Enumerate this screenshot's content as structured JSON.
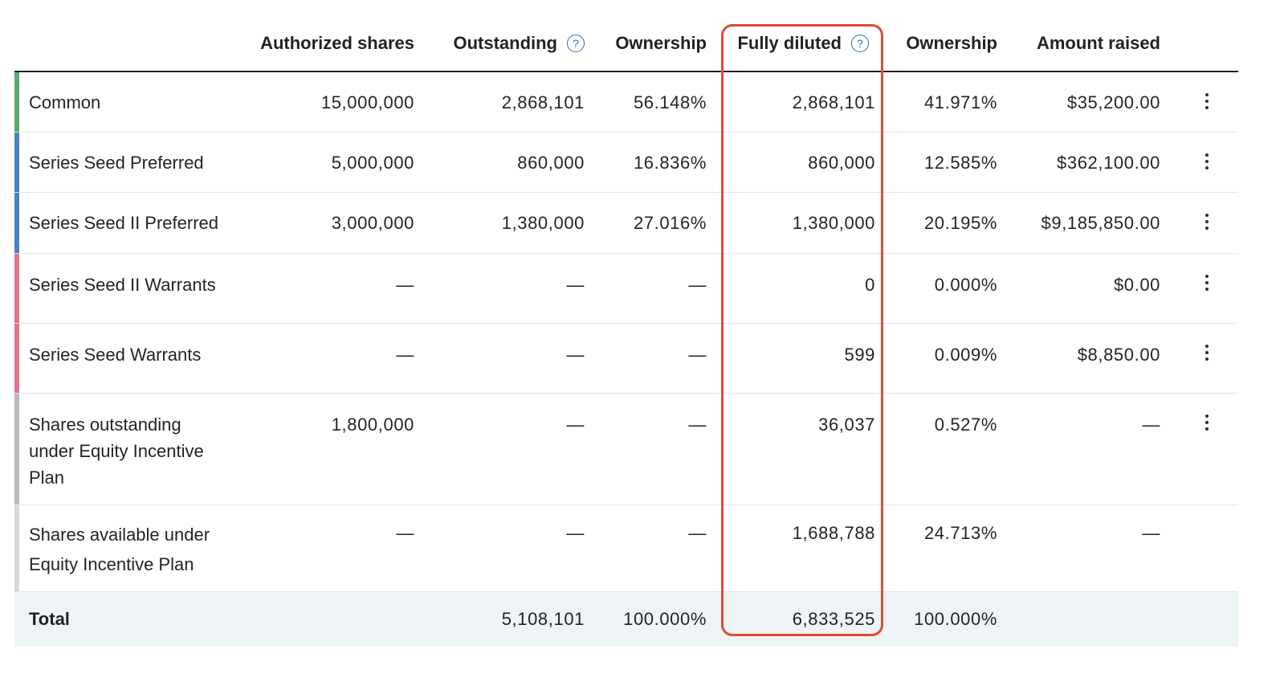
{
  "columns": {
    "authorized": "Authorized shares",
    "outstanding": "Outstanding",
    "ownership1": "Ownership",
    "fully_diluted": "Fully diluted",
    "ownership2": "Ownership",
    "amount_raised": "Amount raised",
    "help_glyph": "?"
  },
  "colors": {
    "accent_highlight": "#e04b32",
    "help_icon": "#2f6fb0",
    "total_row_bg": "#eef4f5",
    "common": "#5aa86f",
    "preferred": "#4a7fc0",
    "warrants": "#e0768a",
    "plan_outstanding": "#b9b9b9",
    "plan_available": "#d8d8d8"
  },
  "rows": [
    {
      "name": "Common",
      "authorized": "15,000,000",
      "outstanding": "2,868,101",
      "ownership1": "56.148%",
      "fully_diluted": "2,868,101",
      "ownership2": "41.971%",
      "amount_raised": "$35,200.00",
      "menu": "more-options"
    },
    {
      "name": "Series Seed Preferred",
      "authorized": "5,000,000",
      "outstanding": "860,000",
      "ownership1": "16.836%",
      "fully_diluted": "860,000",
      "ownership2": "12.585%",
      "amount_raised": "$362,100.00",
      "menu": "more-options"
    },
    {
      "name": "Series Seed II Preferred",
      "authorized": "3,000,000",
      "outstanding": "1,380,000",
      "ownership1": "27.016%",
      "fully_diluted": "1,380,000",
      "ownership2": "20.195%",
      "amount_raised": "$9,185,850.00",
      "menu": "more-options"
    },
    {
      "name": "Series Seed II Warrants",
      "authorized": "—",
      "outstanding": "—",
      "ownership1": "—",
      "fully_diluted": "0",
      "ownership2": "0.000%",
      "amount_raised": "$0.00",
      "menu": "more-options"
    },
    {
      "name": "Series Seed Warrants",
      "authorized": "—",
      "outstanding": "—",
      "ownership1": "—",
      "fully_diluted": "599",
      "ownership2": "0.009%",
      "amount_raised": "$8,850.00",
      "menu": "more-options"
    },
    {
      "name": "Shares outstanding under Equity Incentive Plan",
      "authorized": "1,800,000",
      "outstanding": "—",
      "ownership1": "—",
      "fully_diluted": "36,037",
      "ownership2": "0.527%",
      "amount_raised": "—",
      "menu": "more-options"
    },
    {
      "name": "Shares available under Equity Incentive Plan",
      "authorized": "—",
      "outstanding": "—",
      "ownership1": "—",
      "fully_diluted": "1,688,788",
      "ownership2": "24.713%",
      "amount_raised": "—"
    }
  ],
  "total": {
    "name": "Total",
    "outstanding": "5,108,101",
    "ownership1": "100.000%",
    "fully_diluted": "6,833,525",
    "ownership2": "100.000%"
  }
}
